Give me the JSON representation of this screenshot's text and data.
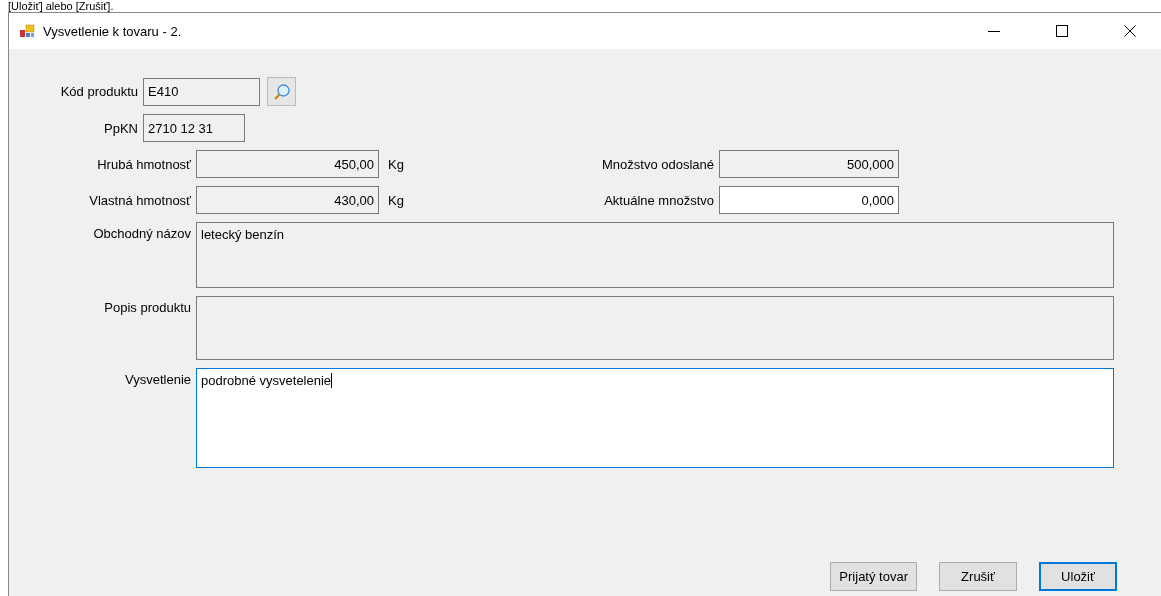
{
  "caption_fragment": "[Uložiť] alebo [Zrušiť].",
  "window": {
    "title": "Vysvetlenie k tovaru - 2."
  },
  "product_code": {
    "label": "Kód produktu",
    "value": "E410",
    "readonly": true
  },
  "ppkn": {
    "label": "PpKN",
    "value": "2710 12 31",
    "readonly": true
  },
  "gross_weight": {
    "label": "Hrubá hmotnosť",
    "value": "450,00",
    "unit": "Kg",
    "readonly": true
  },
  "net_weight": {
    "label": "Vlastná hmotnosť",
    "value": "430,00",
    "unit": "Kg",
    "readonly": true
  },
  "quantity_sent": {
    "label": "Množstvo odoslané",
    "value": "500,000",
    "readonly": true
  },
  "quantity_current": {
    "label": "Aktuálne množstvo",
    "value": "0,000",
    "readonly": false
  },
  "trade_name": {
    "label": "Obchodný názov",
    "value": "letecký benzín",
    "readonly": true
  },
  "description": {
    "label": "Popis produktu",
    "readonly": true
  },
  "explanation": {
    "label": "Vysvetlenie",
    "value": "podrobné vysvetelenie",
    "readonly": false,
    "focused": true
  },
  "buttons": [
    {
      "label": "Prijatý tovar",
      "default": false
    },
    {
      "label": "Zrušiť",
      "default": false
    },
    {
      "label": "Uložiť",
      "default": true
    }
  ]
}
